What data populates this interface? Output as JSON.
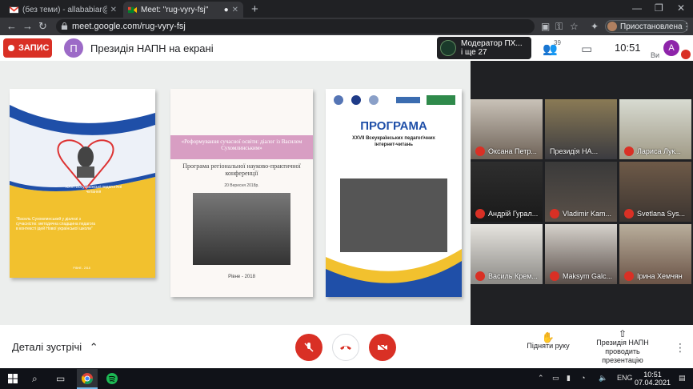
{
  "browser": {
    "tabs": [
      {
        "title": "(без теми) - allababiar@gmail.co",
        "active": false
      },
      {
        "title": "Meet: \"rug-vyry-fsj\"",
        "active": true
      }
    ],
    "url": "meet.google.com/rug-vyry-fsj",
    "profile_label": "Приостановлена"
  },
  "meet": {
    "record_label": "ЗАПИС",
    "presenter_initial": "П",
    "presentation_title": "Президія НАПН на екрані",
    "moderator_line1": "Модератор ПХ...",
    "moderator_line2": "і ще 27",
    "participants_count": "39",
    "clock": "10:51",
    "user_initial": "A",
    "user_short": "Ви"
  },
  "books": {
    "b1_caption": "XXVI Всеукраїнські педагогічні читання",
    "b1_text": "“Василь Сухомлинський у діалозі з сучасністю: методична спадщина педагога в контексті ідей Нової української школи”",
    "b1_year": "РІВНЕ - 2018",
    "b2_title": "«Реформування сучасної освіти: діалог із Василем Сухомлинським»",
    "b2_subtitle": "Програма регіональної науково-практичної конференції",
    "b2_date": "20 Вересня 2018р.",
    "b2_year": "Рівне - 2018",
    "b3_title": "ПРОГРАМА",
    "b3_subtitle": "XXVII Всеукраїнських педагогічних інтернет-читань"
  },
  "participants": [
    {
      "name": "Оксана Петр..."
    },
    {
      "name": "Президія НА..."
    },
    {
      "name": "Лариса Лук..."
    },
    {
      "name": "Андрій Гурал..."
    },
    {
      "name": "Vladimir Kam..."
    },
    {
      "name": "Svetlana Sys..."
    },
    {
      "name": "Василь Крем..."
    },
    {
      "name": "Maksym Galc..."
    },
    {
      "name": "Ірина Хемчян"
    }
  ],
  "bottom": {
    "details_label": "Деталі зустрічі",
    "raise_hand_label": "Підняти руку",
    "presenting_line1": "Президія НАПН",
    "presenting_line2": "проводить презентацію"
  },
  "taskbar": {
    "language": "ENG",
    "time": "10:51",
    "date": "07.04.2021"
  },
  "colors": {
    "record_red": "#d93025",
    "presenter_purple": "#9c6ac7",
    "user_purple": "#8e24aa"
  }
}
